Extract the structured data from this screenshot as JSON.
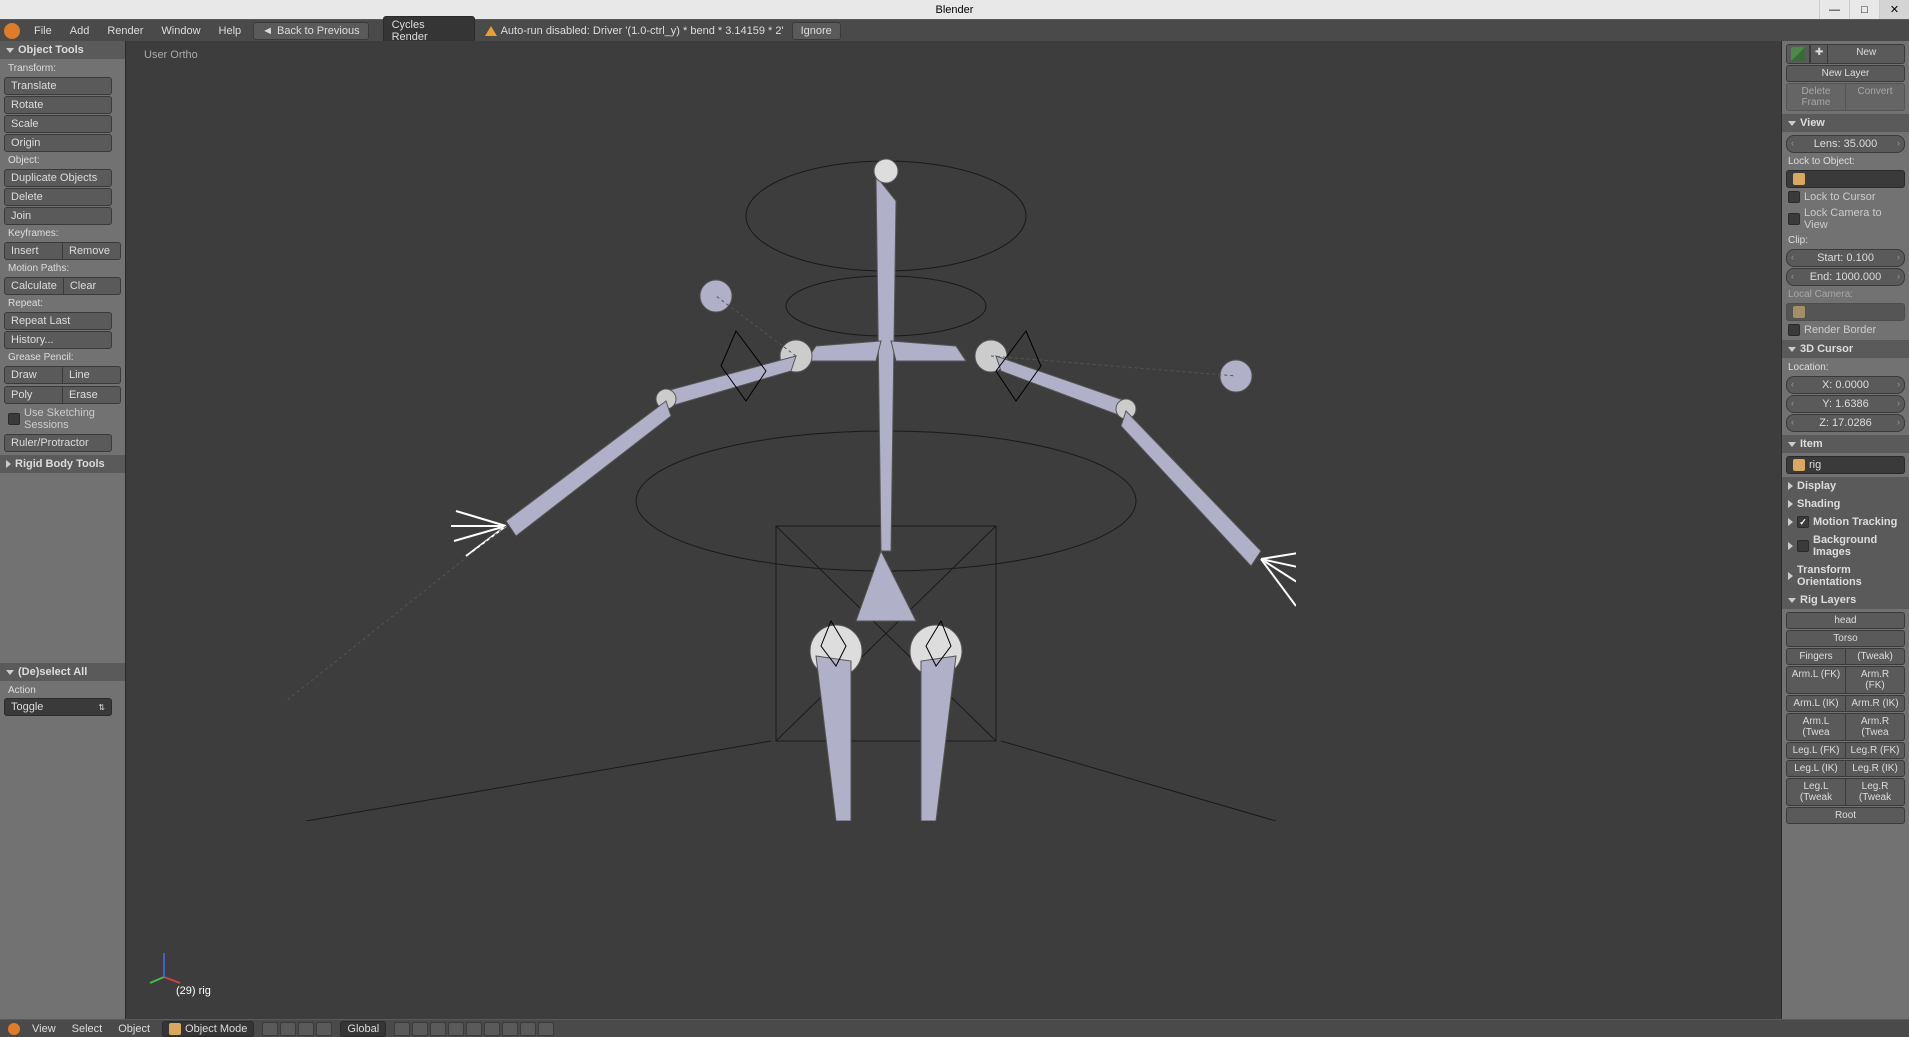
{
  "title": "Blender",
  "menubar": {
    "file": "File",
    "add": "Add",
    "render": "Render",
    "window": "Window",
    "help": "Help",
    "back": "Back to Previous",
    "engine": "Cycles Render",
    "warn": "Auto-run disabled: Driver '(1.0-ctrl_y) * bend * 3.14159 * 2'",
    "ignore": "Ignore"
  },
  "left": {
    "objectTools": "Object Tools",
    "transform": "Transform:",
    "translate": "Translate",
    "rotate": "Rotate",
    "scale": "Scale",
    "origin": "Origin",
    "object": "Object:",
    "duplicate": "Duplicate Objects",
    "delete": "Delete",
    "join": "Join",
    "keyframes": "Keyframes:",
    "insert": "Insert",
    "remove": "Remove",
    "motionPaths": "Motion Paths:",
    "calculate": "Calculate",
    "clear": "Clear",
    "repeat": "Repeat:",
    "repeatLast": "Repeat Last",
    "history": "History...",
    "greasePencil": "Grease Pencil:",
    "draw": "Draw",
    "line": "Line",
    "poly": "Poly",
    "erase": "Erase",
    "sketching": "Use Sketching Sessions",
    "ruler": "Ruler/Protractor",
    "rigidBody": "Rigid Body Tools",
    "deselect": "(De)select All",
    "action": "Action",
    "toggle": "Toggle"
  },
  "viewport": {
    "ortho": "User Ortho",
    "obj": "(29) rig"
  },
  "right": {
    "new": "New",
    "newLayer": "New Layer",
    "deleteFrame": "Delete Frame",
    "convert": "Convert",
    "view": "View",
    "lens": "Lens: 35.000",
    "lockToObject": "Lock to Object:",
    "lockCursor": "Lock to Cursor",
    "lockCamera": "Lock Camera to View",
    "clip": "Clip:",
    "clipStart": "Start: 0.100",
    "clipEnd": "End: 1000.000",
    "localCamera": "Local Camera:",
    "renderBorder": "Render Border",
    "cursor3d": "3D Cursor",
    "location": "Location:",
    "x": "X: 0.0000",
    "y": "Y: 1.6386",
    "z": "Z: 17.0286",
    "item": "Item",
    "rigName": "rig",
    "display": "Display",
    "shading": "Shading",
    "motionTracking": "Motion Tracking",
    "bgImages": "Background Images",
    "transformOrient": "Transform Orientations",
    "rigLayers": "Rig Layers",
    "head": "head",
    "torso": "Torso",
    "fingers": "Fingers",
    "tweak": "(Tweak)",
    "armLFK": "Arm.L (FK)",
    "armRFK": "Arm.R (FK)",
    "armLIK": "Arm.L (IK)",
    "armRIK": "Arm.R (IK)",
    "armLTw": "Arm.L (Twea",
    "armRTw": "Arm.R (Twea",
    "legLFK": "Leg.L (FK)",
    "legRFK": "Leg.R (FK)",
    "legLIK": "Leg.L (IK)",
    "legRIK": "Leg.R (IK)",
    "legLTw": "Leg.L (Tweak",
    "legRTw": "Leg.R (Tweak",
    "root": "Root"
  },
  "bottom": {
    "view": "View",
    "select": "Select",
    "object": "Object",
    "mode": "Object Mode",
    "global": "Global"
  }
}
